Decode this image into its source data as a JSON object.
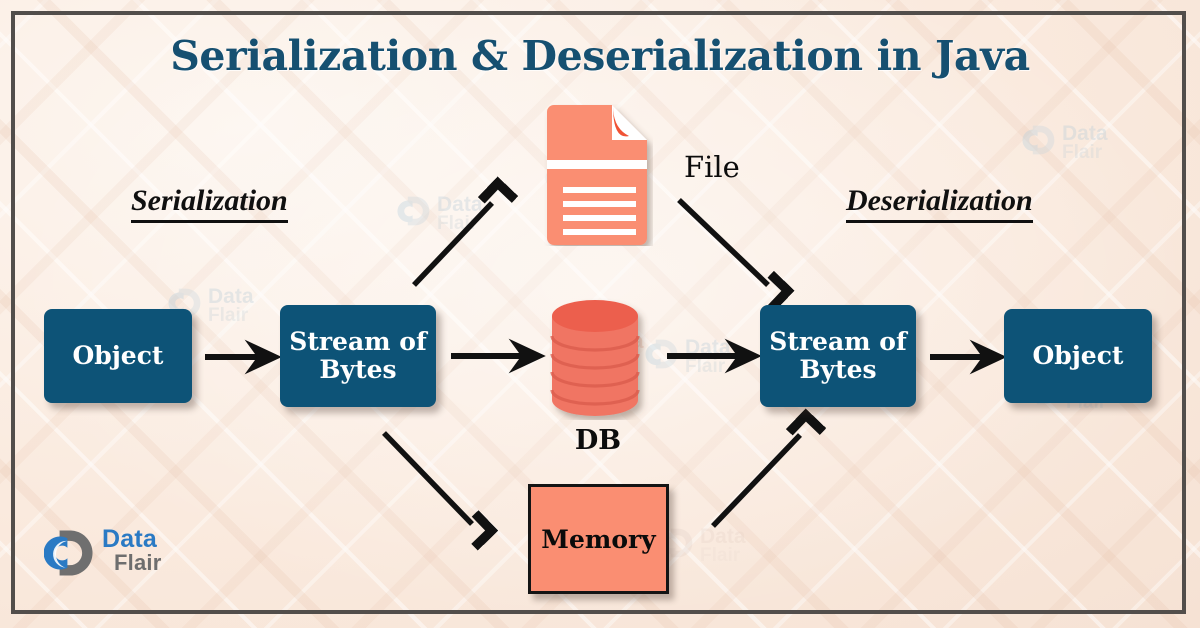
{
  "page": {
    "title": "Serialization & Deserialization in Java",
    "frame_color": "#524e4b",
    "background_color": "#fbf0e8"
  },
  "sections": {
    "left_heading": "Serialization",
    "right_heading": "Deserialization"
  },
  "nodes": {
    "object_left": "Object",
    "stream_left": "Stream of\nBytes",
    "stream_right": "Stream of\nBytes",
    "object_right": "Object",
    "memory": "Memory",
    "db_label": "DB",
    "file_label": "File"
  },
  "colors": {
    "box_blue": "#0d5377",
    "accent_salmon": "#fa8e72",
    "db_coral": "#ef6d59",
    "title_teal": "#165071",
    "arrow_black": "#111111"
  },
  "logo": {
    "data": "Data",
    "flair": "Flair"
  },
  "watermarks": [
    {
      "data": "Data",
      "flair": "Flair"
    },
    {
      "data": "Data",
      "flair": "Flair"
    },
    {
      "data": "Data",
      "flair": "Flair"
    },
    {
      "data": "Data",
      "flair": "Flair"
    },
    {
      "data": "Data",
      "flair": "Flair"
    },
    {
      "data": "Data",
      "flair": "Flair"
    },
    {
      "data": "Data",
      "flair": "Flair"
    }
  ],
  "flow": {
    "description": "Serialization converts an Object into a Stream of Bytes which is persisted to a File, a DB, or Memory; Deserialization reads those back into a Stream of Bytes and then an Object.",
    "edges": [
      {
        "from": "Object",
        "to": "Stream of Bytes",
        "direction": "right"
      },
      {
        "from": "Stream of Bytes",
        "to": "File",
        "direction": "up-right"
      },
      {
        "from": "Stream of Bytes",
        "to": "DB",
        "direction": "right"
      },
      {
        "from": "Stream of Bytes",
        "to": "Memory",
        "direction": "down-right"
      },
      {
        "from": "File",
        "to": "Stream of Bytes",
        "direction": "down-right"
      },
      {
        "from": "DB",
        "to": "Stream of Bytes",
        "direction": "right"
      },
      {
        "from": "Memory",
        "to": "Stream of Bytes",
        "direction": "up-right"
      },
      {
        "from": "Stream of Bytes",
        "to": "Object",
        "direction": "right"
      }
    ]
  }
}
